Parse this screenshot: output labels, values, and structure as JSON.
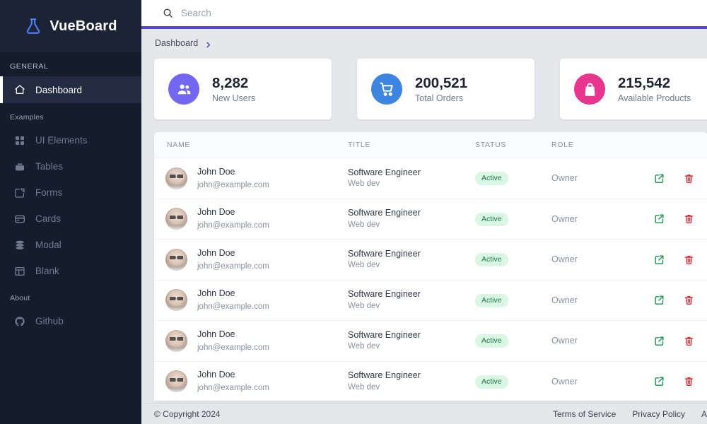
{
  "brand": {
    "name": "VueBoard",
    "icon": "flask-icon"
  },
  "sidebar": {
    "sections": [
      {
        "label": "GENERAL"
      },
      {
        "label": "Examples"
      },
      {
        "label": "About"
      }
    ],
    "items": [
      {
        "label": "Dashboard",
        "icon": "home-icon",
        "active": true
      },
      {
        "label": "UI Elements",
        "icon": "grid-icon",
        "active": false
      },
      {
        "label": "Tables",
        "icon": "table-icon",
        "active": false
      },
      {
        "label": "Forms",
        "icon": "form-edit-icon",
        "active": false
      },
      {
        "label": "Cards",
        "icon": "card-icon",
        "active": false
      },
      {
        "label": "Modal",
        "icon": "layers-icon",
        "active": false
      },
      {
        "label": "Blank",
        "icon": "blank-page-icon",
        "active": false
      },
      {
        "label": "Github",
        "icon": "github-icon",
        "active": false
      }
    ]
  },
  "topbar": {
    "search_placeholder": "Search",
    "search_value": "",
    "search_icon": "search-icon",
    "accent_color": "#5548d9"
  },
  "breadcrumb": {
    "items": [
      "Dashboard"
    ],
    "chevron_icon": "chevron-right-icon"
  },
  "stats": [
    {
      "value": "8,282",
      "label": "New Users",
      "icon": "users-icon",
      "color": "#7367ef"
    },
    {
      "value": "200,521",
      "label": "Total Orders",
      "icon": "cart-icon",
      "color": "#3d85e0"
    },
    {
      "value": "215,542",
      "label": "Available Products",
      "icon": "bag-icon",
      "color": "#e8368f"
    }
  ],
  "table": {
    "columns": [
      "NAME",
      "TITLE",
      "STATUS",
      "ROLE",
      ""
    ],
    "rows": [
      {
        "name": "John Doe",
        "email": "john@example.com",
        "title": "Software Engineer",
        "subtitle": "Web dev",
        "status": "Active",
        "role": "Owner",
        "edit_icon": "edit-icon",
        "delete_icon": "trash-icon"
      },
      {
        "name": "John Doe",
        "email": "john@example.com",
        "title": "Software Engineer",
        "subtitle": "Web dev",
        "status": "Active",
        "role": "Owner",
        "edit_icon": "edit-icon",
        "delete_icon": "trash-icon"
      },
      {
        "name": "John Doe",
        "email": "john@example.com",
        "title": "Software Engineer",
        "subtitle": "Web dev",
        "status": "Active",
        "role": "Owner",
        "edit_icon": "edit-icon",
        "delete_icon": "trash-icon"
      },
      {
        "name": "John Doe",
        "email": "john@example.com",
        "title": "Software Engineer",
        "subtitle": "Web dev",
        "status": "Active",
        "role": "Owner",
        "edit_icon": "edit-icon",
        "delete_icon": "trash-icon"
      },
      {
        "name": "John Doe",
        "email": "john@example.com",
        "title": "Software Engineer",
        "subtitle": "Web dev",
        "status": "Active",
        "role": "Owner",
        "edit_icon": "edit-icon",
        "delete_icon": "trash-icon"
      },
      {
        "name": "John Doe",
        "email": "john@example.com",
        "title": "Software Engineer",
        "subtitle": "Web dev",
        "status": "Active",
        "role": "Owner",
        "edit_icon": "edit-icon",
        "delete_icon": "trash-icon"
      }
    ],
    "status_color_bg": "#d9f7e3",
    "status_color_fg": "#18794a"
  },
  "footer": {
    "copyright": "© Copyright 2024",
    "links": [
      "Terms of Service",
      "Privacy Policy",
      "A"
    ]
  }
}
